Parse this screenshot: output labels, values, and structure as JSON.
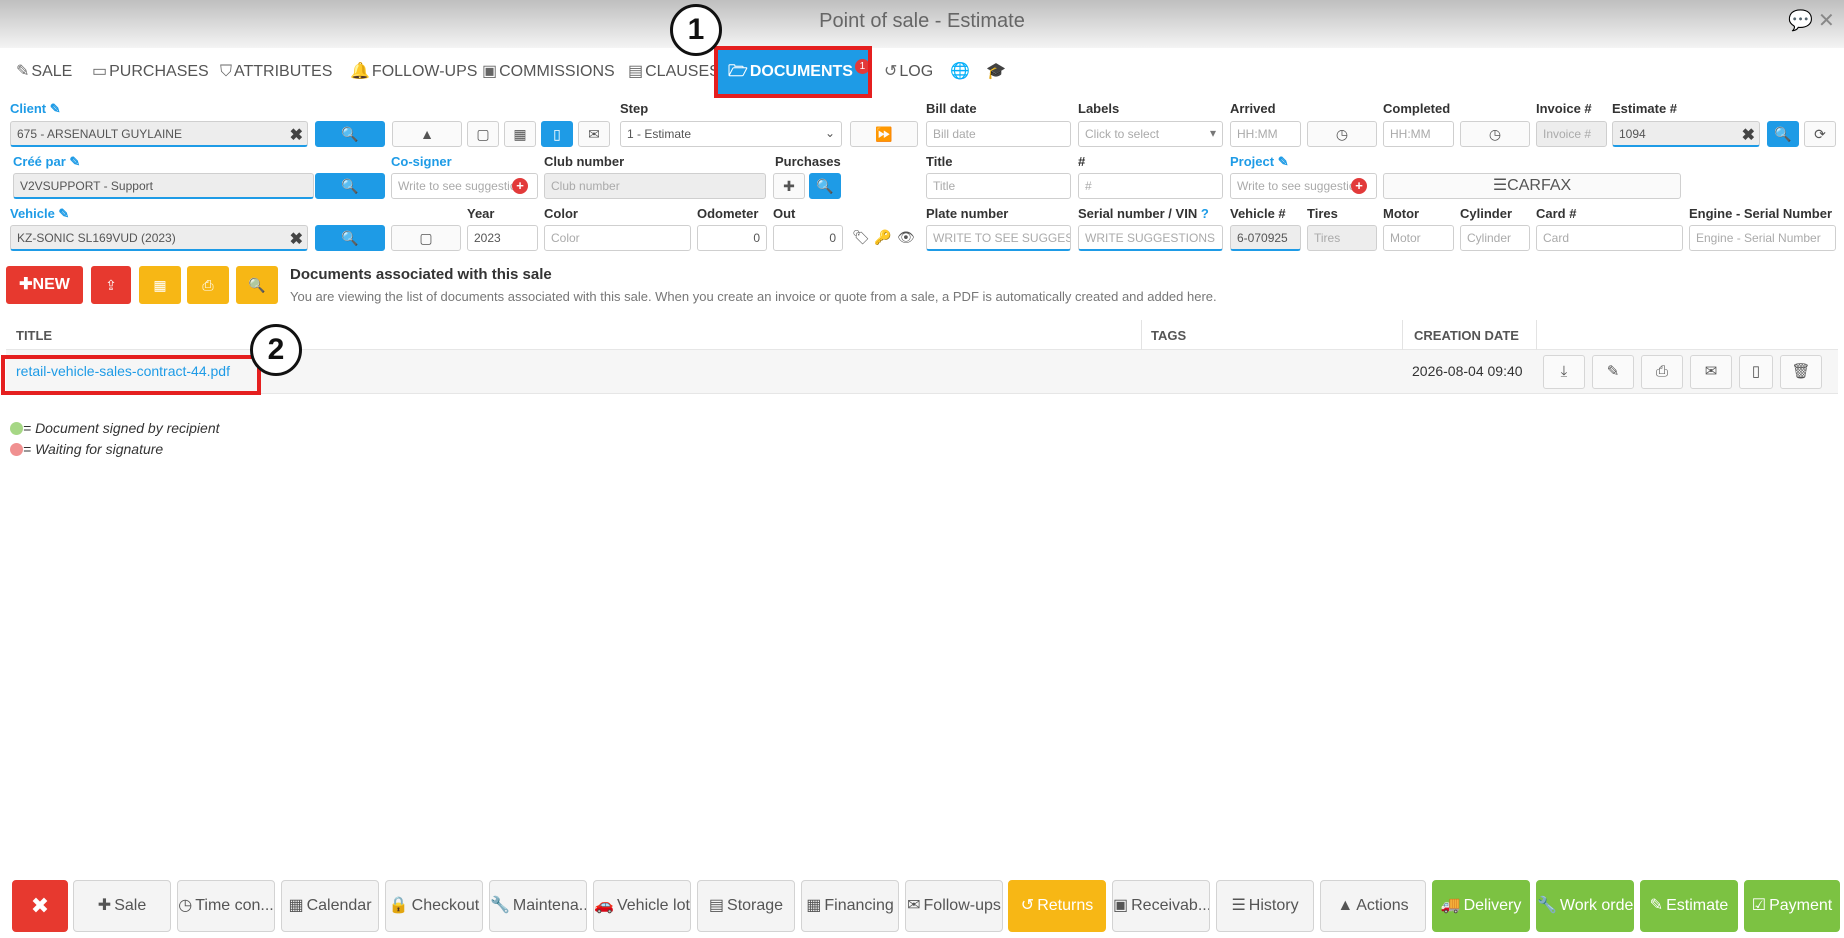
{
  "window": {
    "title": "Point of sale - Estimate"
  },
  "tabs": [
    {
      "label": "SALE",
      "icon": "edit-icon"
    },
    {
      "label": "PURCHASES",
      "icon": "credit-card-icon"
    },
    {
      "label": "ATTRIBUTES",
      "icon": "tags-icon"
    },
    {
      "label": "FOLLOW-UPS",
      "icon": "bell-icon"
    },
    {
      "label": "COMMISSIONS",
      "icon": "money-icon"
    },
    {
      "label": "CLAUSES",
      "icon": "file-text-icon"
    },
    {
      "label": "DOCUMENTS",
      "icon": "folder-open-icon",
      "badge": "1",
      "active": true
    },
    {
      "label": "LOG",
      "icon": "history-icon"
    }
  ],
  "markers": {
    "one": "1",
    "two": "2"
  },
  "form": {
    "client": {
      "label": "Client",
      "value": "675 - ARSENAULT GUYLAINE"
    },
    "step": {
      "label": "Step",
      "value": "1 - Estimate"
    },
    "bill_date": {
      "label": "Bill date",
      "placeholder": "Bill date"
    },
    "labels": {
      "label": "Labels",
      "placeholder": "Click to select"
    },
    "arrived": {
      "label": "Arrived",
      "placeholder": "HH:MM"
    },
    "completed": {
      "label": "Completed",
      "placeholder": "HH:MM"
    },
    "invoice_no": {
      "label": "Invoice #",
      "placeholder": "Invoice #"
    },
    "estimate_no": {
      "label": "Estimate #",
      "value": "1094"
    },
    "cree_par": {
      "label": "Créé par",
      "value": "V2VSUPPORT - Support"
    },
    "cosigner": {
      "label": "Co-signer",
      "placeholder": "Write to see suggestion"
    },
    "club_number": {
      "label": "Club number",
      "placeholder": "Club number"
    },
    "purchases": {
      "label": "Purchases"
    },
    "title_field": {
      "label": "Title",
      "placeholder": "Title"
    },
    "hash": {
      "label": "#",
      "placeholder": "#"
    },
    "project": {
      "label": "Project",
      "placeholder": "Write to see suggestion"
    },
    "carfax": {
      "label": "CARFAX"
    },
    "vehicle": {
      "label": "Vehicle",
      "value": "KZ-SONIC SL169VUD (2023)"
    },
    "year": {
      "label": "Year",
      "value": "2023"
    },
    "color": {
      "label": "Color",
      "placeholder": "Color"
    },
    "odometer": {
      "label": "Odometer",
      "value": "0"
    },
    "out": {
      "label": "Out",
      "value": "0"
    },
    "plate_number": {
      "label": "Plate number",
      "placeholder": "WRITE TO SEE SUGGESTIONS"
    },
    "serial_vin": {
      "label": "Serial number / VIN",
      "placeholder": "WRITE SUGGESTIONS"
    },
    "vehicle_no": {
      "label": "Vehicle #",
      "value": "6-070925"
    },
    "tires": {
      "label": "Tires",
      "placeholder": "Tires"
    },
    "motor": {
      "label": "Motor",
      "placeholder": "Motor"
    },
    "cylinder": {
      "label": "Cylinder",
      "placeholder": "Cylinder"
    },
    "card_no": {
      "label": "Card #",
      "placeholder": "Card"
    },
    "engine_serial": {
      "label": "Engine - Serial Number",
      "placeholder": "Engine - Serial Number"
    }
  },
  "toolbar": {
    "new_label": "NEW"
  },
  "documents": {
    "title": "Documents associated with this sale",
    "description": "You are viewing the list of documents associated with this sale. When you create an invoice or quote from a sale, a PDF is automatically created and added here.",
    "columns": {
      "title": "TITLE",
      "tags": "TAGS",
      "creation_date": "CREATION DATE"
    },
    "rows": [
      {
        "title": "retail-vehicle-sales-contract-44.pdf",
        "tags": "",
        "creation_date": "2026-08-04 09:40"
      }
    ]
  },
  "legend": {
    "signed": "= Document signed by recipient",
    "waiting": "= Waiting for signature",
    "signed_color": "#a6d785",
    "waiting_color": "#f09090"
  },
  "bottom_bar": {
    "sale": "Sale",
    "time_con": "Time con...",
    "calendar": "Calendar",
    "checkout": "Checkout",
    "maintenance": "Maintena...",
    "vehicle_lot": "Vehicle lot",
    "storage": "Storage",
    "financing": "Financing",
    "followups": "Follow-ups",
    "returns": "Returns",
    "receivables": "Receivab...",
    "history": "History",
    "actions": "Actions",
    "delivery": "Delivery",
    "work_order": "Work order",
    "estimate": "Estimate",
    "payment": "Payment"
  },
  "colors": {
    "accent": "#1e9be6",
    "danger": "#e7392f",
    "warning": "#f7b715",
    "success": "#7cc242"
  }
}
